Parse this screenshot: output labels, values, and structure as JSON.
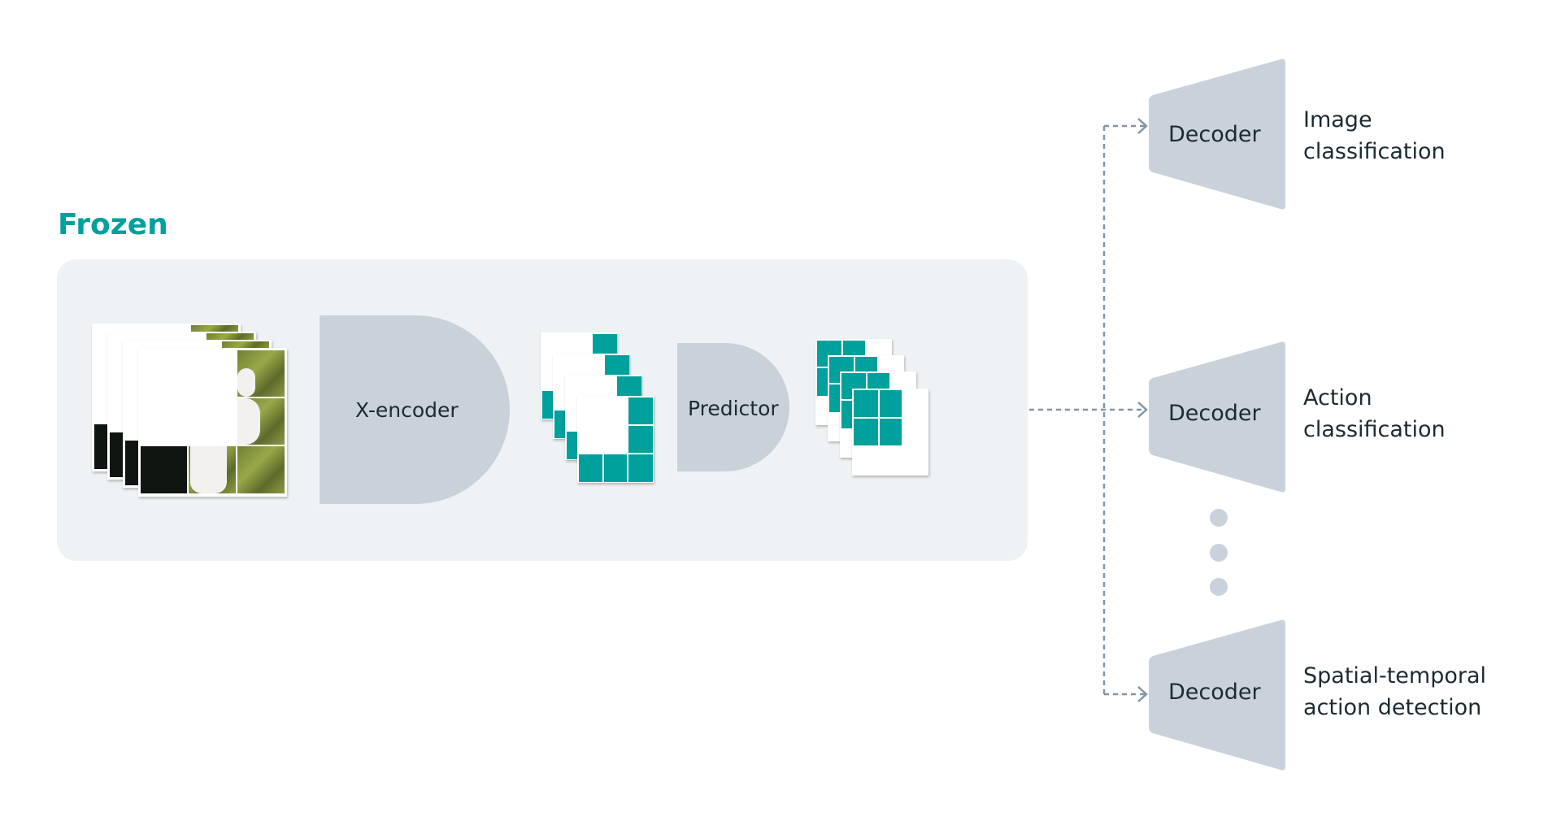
{
  "frozen": {
    "label": "Frozen",
    "color": "#00a09d"
  },
  "encoder": {
    "label": "X-encoder"
  },
  "predictor": {
    "label": "Predictor"
  },
  "decoders": [
    {
      "label": "Decoder",
      "task_line1": "Image",
      "task_line2": "classification"
    },
    {
      "label": "Decoder",
      "task_line1": "Action",
      "task_line2": "classification"
    },
    {
      "label": "Decoder",
      "task_line1": "Spatial-temporal",
      "task_line2": "action detection"
    }
  ],
  "colors": {
    "panel": "#eff2f5",
    "shape": "#c9d1db",
    "accent": "#00a09d",
    "arrow": "#8296a6",
    "text": "#1c2b33"
  }
}
